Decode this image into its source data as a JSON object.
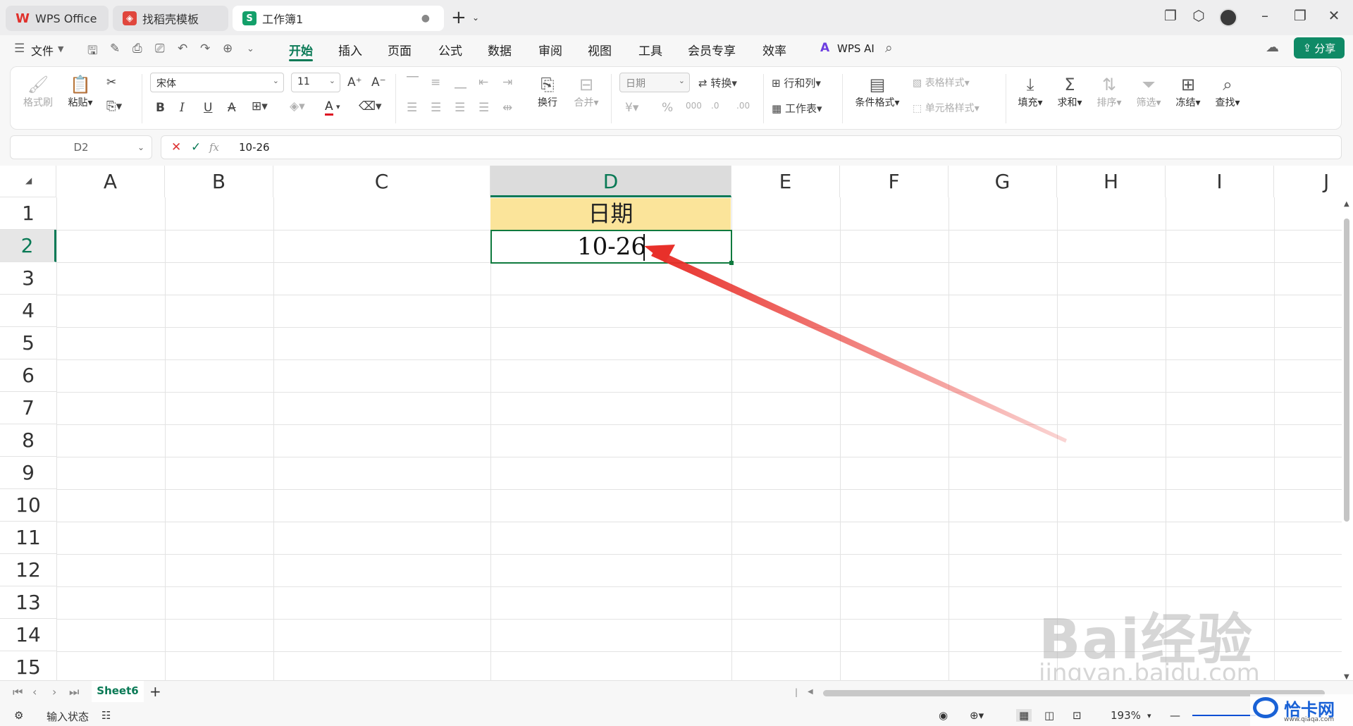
{
  "tabs": [
    {
      "label": "WPS Office",
      "icon": "W"
    },
    {
      "label": "找稻壳模板",
      "icon": "◈"
    },
    {
      "label": "工作簿1",
      "icon": "S"
    }
  ],
  "menu": {
    "file": "文件",
    "items": [
      "开始",
      "插入",
      "页面",
      "公式",
      "数据",
      "审阅",
      "视图",
      "工具",
      "会员专享",
      "效率"
    ],
    "ai": "WPS AI",
    "share": "分享"
  },
  "ribbon": {
    "format_painter": "格式刷",
    "paste": "粘贴",
    "font_name": "宋体",
    "font_size": "11",
    "wrap": "换行",
    "merge": "合并",
    "number_format": "日期",
    "convert": "转换",
    "rows_cols": "行和列",
    "worksheet": "工作表",
    "cond_format": "条件格式",
    "table_style": "表格样式",
    "cell_style": "单元格样式",
    "fill": "填充",
    "sum": "求和",
    "sort": "排序",
    "filter": "筛选",
    "freeze": "冻结",
    "find": "查找"
  },
  "formula_bar": {
    "name_box": "D2",
    "fx": "fx",
    "content": "10-26"
  },
  "grid": {
    "columns": [
      "A",
      "B",
      "C",
      "D",
      "E",
      "F",
      "G",
      "H",
      "I",
      "J"
    ],
    "rows": [
      "1",
      "2",
      "3",
      "4",
      "5",
      "6",
      "7",
      "8",
      "9",
      "10",
      "11",
      "12",
      "13",
      "14",
      "15"
    ],
    "selected_cell": "D2",
    "d1": "日期",
    "d2": "10-26"
  },
  "sheets": [
    "Sheet6"
  ],
  "status": {
    "mode": "输入状态",
    "zoom": "193%"
  },
  "watermarks": {
    "baidu": "Bai经验",
    "url": "jingyan.baidu.com",
    "site": "恰卡网",
    "site_url": "www.qiaqa.com"
  },
  "colors": {
    "accent": "#0a7a56",
    "header_fill": "#fbe49a",
    "arrow": "#e8302a"
  }
}
